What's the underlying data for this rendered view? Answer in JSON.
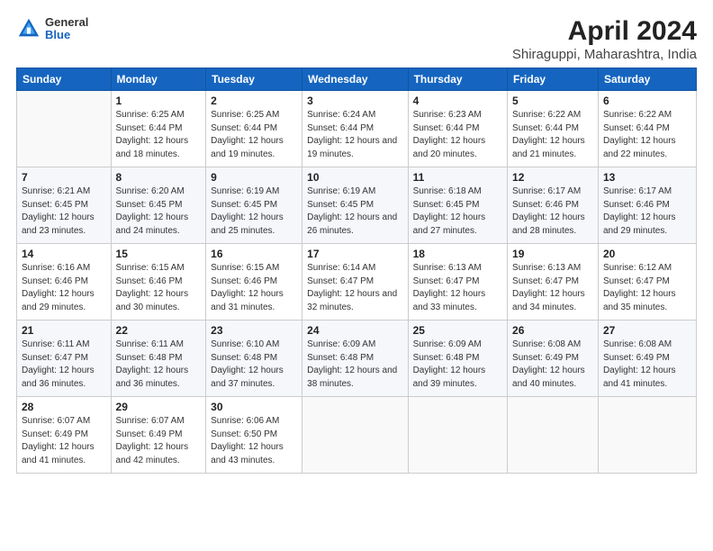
{
  "logo": {
    "general": "General",
    "blue": "Blue"
  },
  "header": {
    "title": "April 2024",
    "subtitle": "Shiraguppi, Maharashtra, India"
  },
  "days_of_week": [
    "Sunday",
    "Monday",
    "Tuesday",
    "Wednesday",
    "Thursday",
    "Friday",
    "Saturday"
  ],
  "weeks": [
    [
      {
        "day": "",
        "sunrise": "",
        "sunset": "",
        "daylight": ""
      },
      {
        "day": "1",
        "sunrise": "Sunrise: 6:25 AM",
        "sunset": "Sunset: 6:44 PM",
        "daylight": "Daylight: 12 hours and 18 minutes."
      },
      {
        "day": "2",
        "sunrise": "Sunrise: 6:25 AM",
        "sunset": "Sunset: 6:44 PM",
        "daylight": "Daylight: 12 hours and 19 minutes."
      },
      {
        "day": "3",
        "sunrise": "Sunrise: 6:24 AM",
        "sunset": "Sunset: 6:44 PM",
        "daylight": "Daylight: 12 hours and 19 minutes."
      },
      {
        "day": "4",
        "sunrise": "Sunrise: 6:23 AM",
        "sunset": "Sunset: 6:44 PM",
        "daylight": "Daylight: 12 hours and 20 minutes."
      },
      {
        "day": "5",
        "sunrise": "Sunrise: 6:22 AM",
        "sunset": "Sunset: 6:44 PM",
        "daylight": "Daylight: 12 hours and 21 minutes."
      },
      {
        "day": "6",
        "sunrise": "Sunrise: 6:22 AM",
        "sunset": "Sunset: 6:44 PM",
        "daylight": "Daylight: 12 hours and 22 minutes."
      }
    ],
    [
      {
        "day": "7",
        "sunrise": "Sunrise: 6:21 AM",
        "sunset": "Sunset: 6:45 PM",
        "daylight": "Daylight: 12 hours and 23 minutes."
      },
      {
        "day": "8",
        "sunrise": "Sunrise: 6:20 AM",
        "sunset": "Sunset: 6:45 PM",
        "daylight": "Daylight: 12 hours and 24 minutes."
      },
      {
        "day": "9",
        "sunrise": "Sunrise: 6:19 AM",
        "sunset": "Sunset: 6:45 PM",
        "daylight": "Daylight: 12 hours and 25 minutes."
      },
      {
        "day": "10",
        "sunrise": "Sunrise: 6:19 AM",
        "sunset": "Sunset: 6:45 PM",
        "daylight": "Daylight: 12 hours and 26 minutes."
      },
      {
        "day": "11",
        "sunrise": "Sunrise: 6:18 AM",
        "sunset": "Sunset: 6:45 PM",
        "daylight": "Daylight: 12 hours and 27 minutes."
      },
      {
        "day": "12",
        "sunrise": "Sunrise: 6:17 AM",
        "sunset": "Sunset: 6:46 PM",
        "daylight": "Daylight: 12 hours and 28 minutes."
      },
      {
        "day": "13",
        "sunrise": "Sunrise: 6:17 AM",
        "sunset": "Sunset: 6:46 PM",
        "daylight": "Daylight: 12 hours and 29 minutes."
      }
    ],
    [
      {
        "day": "14",
        "sunrise": "Sunrise: 6:16 AM",
        "sunset": "Sunset: 6:46 PM",
        "daylight": "Daylight: 12 hours and 29 minutes."
      },
      {
        "day": "15",
        "sunrise": "Sunrise: 6:15 AM",
        "sunset": "Sunset: 6:46 PM",
        "daylight": "Daylight: 12 hours and 30 minutes."
      },
      {
        "day": "16",
        "sunrise": "Sunrise: 6:15 AM",
        "sunset": "Sunset: 6:46 PM",
        "daylight": "Daylight: 12 hours and 31 minutes."
      },
      {
        "day": "17",
        "sunrise": "Sunrise: 6:14 AM",
        "sunset": "Sunset: 6:47 PM",
        "daylight": "Daylight: 12 hours and 32 minutes."
      },
      {
        "day": "18",
        "sunrise": "Sunrise: 6:13 AM",
        "sunset": "Sunset: 6:47 PM",
        "daylight": "Daylight: 12 hours and 33 minutes."
      },
      {
        "day": "19",
        "sunrise": "Sunrise: 6:13 AM",
        "sunset": "Sunset: 6:47 PM",
        "daylight": "Daylight: 12 hours and 34 minutes."
      },
      {
        "day": "20",
        "sunrise": "Sunrise: 6:12 AM",
        "sunset": "Sunset: 6:47 PM",
        "daylight": "Daylight: 12 hours and 35 minutes."
      }
    ],
    [
      {
        "day": "21",
        "sunrise": "Sunrise: 6:11 AM",
        "sunset": "Sunset: 6:47 PM",
        "daylight": "Daylight: 12 hours and 36 minutes."
      },
      {
        "day": "22",
        "sunrise": "Sunrise: 6:11 AM",
        "sunset": "Sunset: 6:48 PM",
        "daylight": "Daylight: 12 hours and 36 minutes."
      },
      {
        "day": "23",
        "sunrise": "Sunrise: 6:10 AM",
        "sunset": "Sunset: 6:48 PM",
        "daylight": "Daylight: 12 hours and 37 minutes."
      },
      {
        "day": "24",
        "sunrise": "Sunrise: 6:09 AM",
        "sunset": "Sunset: 6:48 PM",
        "daylight": "Daylight: 12 hours and 38 minutes."
      },
      {
        "day": "25",
        "sunrise": "Sunrise: 6:09 AM",
        "sunset": "Sunset: 6:48 PM",
        "daylight": "Daylight: 12 hours and 39 minutes."
      },
      {
        "day": "26",
        "sunrise": "Sunrise: 6:08 AM",
        "sunset": "Sunset: 6:49 PM",
        "daylight": "Daylight: 12 hours and 40 minutes."
      },
      {
        "day": "27",
        "sunrise": "Sunrise: 6:08 AM",
        "sunset": "Sunset: 6:49 PM",
        "daylight": "Daylight: 12 hours and 41 minutes."
      }
    ],
    [
      {
        "day": "28",
        "sunrise": "Sunrise: 6:07 AM",
        "sunset": "Sunset: 6:49 PM",
        "daylight": "Daylight: 12 hours and 41 minutes."
      },
      {
        "day": "29",
        "sunrise": "Sunrise: 6:07 AM",
        "sunset": "Sunset: 6:49 PM",
        "daylight": "Daylight: 12 hours and 42 minutes."
      },
      {
        "day": "30",
        "sunrise": "Sunrise: 6:06 AM",
        "sunset": "Sunset: 6:50 PM",
        "daylight": "Daylight: 12 hours and 43 minutes."
      },
      {
        "day": "",
        "sunrise": "",
        "sunset": "",
        "daylight": ""
      },
      {
        "day": "",
        "sunrise": "",
        "sunset": "",
        "daylight": ""
      },
      {
        "day": "",
        "sunrise": "",
        "sunset": "",
        "daylight": ""
      },
      {
        "day": "",
        "sunrise": "",
        "sunset": "",
        "daylight": ""
      }
    ]
  ]
}
